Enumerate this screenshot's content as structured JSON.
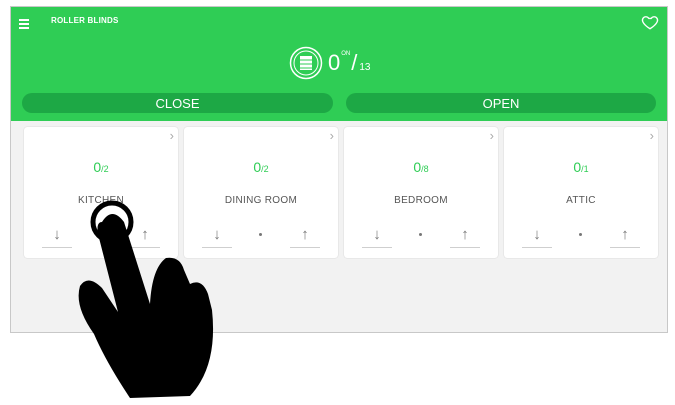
{
  "header": {
    "title": "ROLLER BLINDS",
    "count_on": "0",
    "count_suffix": "ON",
    "count_slash": "/",
    "count_total": "13",
    "accent": "#2fcd55",
    "button_color": "#1da845"
  },
  "actions": {
    "close_label": "CLOSE",
    "open_label": "OPEN"
  },
  "rooms": [
    {
      "name": "KITCHEN",
      "count": "0",
      "total": "/2"
    },
    {
      "name": "DINING ROOM",
      "count": "0",
      "total": "/2"
    },
    {
      "name": "BEDROOM",
      "count": "0",
      "total": "/8"
    },
    {
      "name": "ATTIC",
      "count": "0",
      "total": "/1"
    }
  ],
  "icons": {
    "chevron": "›",
    "down": "↓",
    "up": "↑"
  }
}
